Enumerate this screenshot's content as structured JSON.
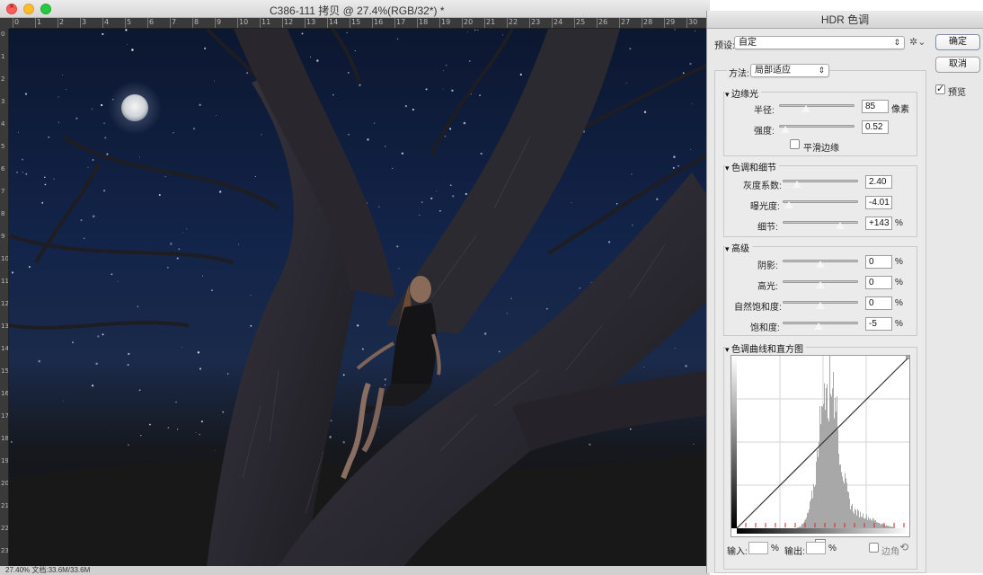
{
  "document": {
    "title": "C386-111 拷贝 @ 27.4%(RGB/32*) *",
    "status": "27.40%   文档:33.6M/33.6M",
    "ruler_labels": [
      "0",
      "1",
      "2",
      "3",
      "4",
      "5",
      "6",
      "7",
      "8",
      "9",
      "10",
      "11",
      "12",
      "13",
      "14",
      "15",
      "16",
      "17",
      "18",
      "19",
      "20",
      "21",
      "22",
      "23",
      "24",
      "25",
      "26",
      "27",
      "28",
      "29",
      "30"
    ]
  },
  "dialog": {
    "title": "HDR 色调",
    "preset_label": "预设:",
    "preset_value": "自定",
    "ok_label": "确定",
    "cancel_label": "取消",
    "preview_label": "预览",
    "preview_checked": true,
    "method_label": "方法:",
    "method_value": "局部适应",
    "edge_glow": {
      "title": "边缘光",
      "radius_label": "半径:",
      "radius_value": "85",
      "radius_unit": "像素",
      "strength_label": "强度:",
      "strength_value": "0.52",
      "smooth_label": "平滑边缘",
      "smooth_checked": false
    },
    "tone_detail": {
      "title": "色调和细节",
      "gamma_label": "灰度系数:",
      "gamma_value": "2.40",
      "exposure_label": "曝光度:",
      "exposure_value": "-4.01",
      "detail_label": "细节:",
      "detail_value": "+143",
      "detail_unit": "%"
    },
    "advanced": {
      "title": "高级",
      "shadow_label": "阴影:",
      "shadow_value": "0",
      "highlight_label": "高光:",
      "highlight_value": "0",
      "vibrance_label": "自然饱和度:",
      "vibrance_value": "0",
      "saturation_label": "饱和度:",
      "saturation_value": "-5",
      "unit": "%"
    },
    "curve": {
      "title": "色调曲线和直方图",
      "input_label": "输入:",
      "output_label": "输出:",
      "percent": "%",
      "corner_label": "边角"
    }
  }
}
